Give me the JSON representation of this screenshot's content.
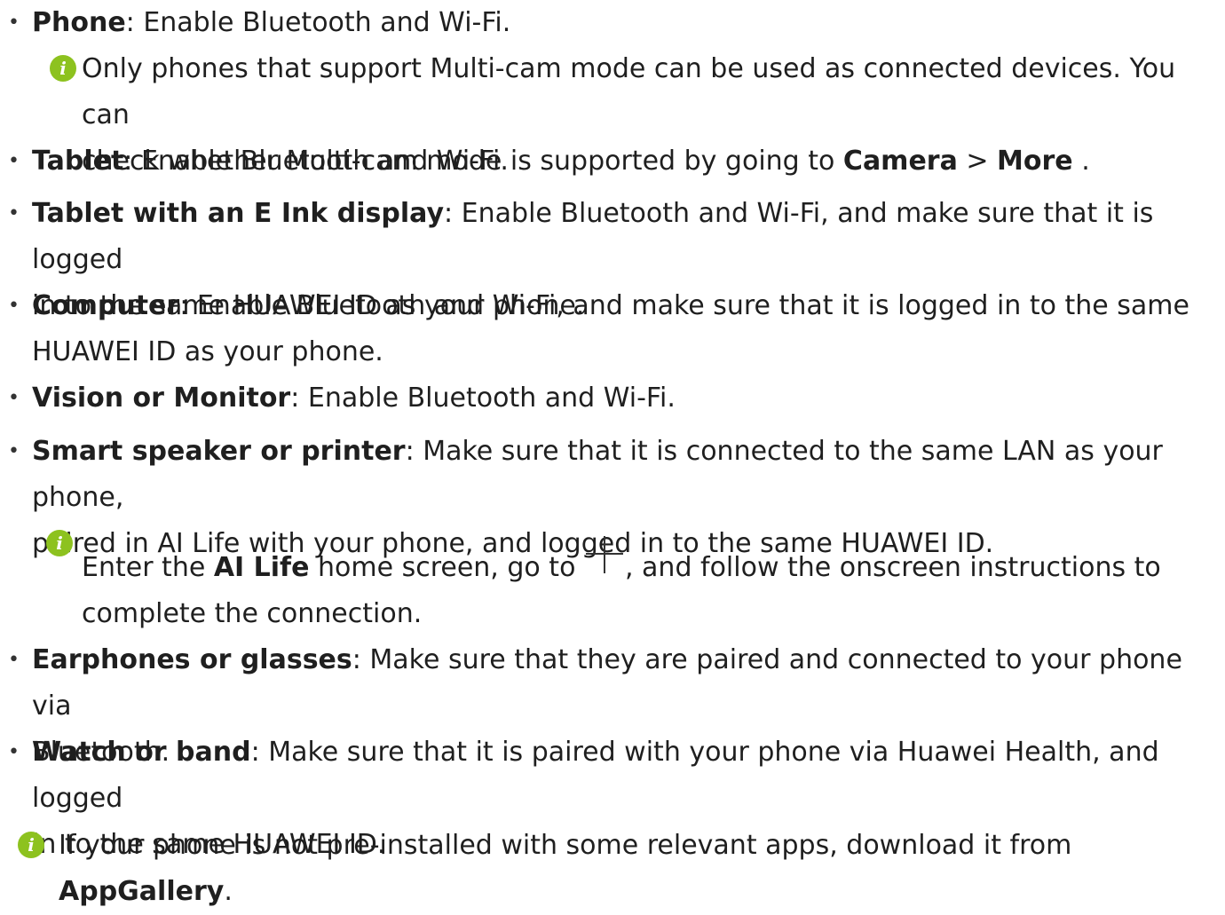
{
  "items": [
    {
      "bold": "Phone",
      "text": ": Enable Bluetooth and Wi-Fi."
    },
    {
      "bold": "Tablet",
      "text": ": Enable Bluetooth and Wi-Fi."
    },
    {
      "bold": "Tablet with an E Ink display",
      "text": ": Enable Bluetooth and Wi-Fi, and make sure that it is logged",
      "line2": "in to the same HUAWEI ID as your phone."
    },
    {
      "bold": "Computer",
      "text": ": Enable Bluetooth and Wi-Fi, and make sure that it is logged in to the same",
      "line2": "HUAWEI ID as your phone."
    },
    {
      "bold": "Vision or Monitor",
      "text": ": Enable Bluetooth and Wi-Fi."
    },
    {
      "bold": "Smart speaker or printer",
      "text": ": Make sure that it is connected to the same LAN as your phone,",
      "line2": "paired in AI Life with your phone, and logged in to the same HUAWEI ID."
    },
    {
      "bold": "Earphones or glasses",
      "text": ": Make sure that they are paired and connected to your phone via",
      "line2": "Bluetooth."
    },
    {
      "bold": "Watch or band",
      "text": ": Make sure that it is paired with your phone via Huawei Health, and logged",
      "line2": "in to the same HUAWEI ID."
    }
  ],
  "notes": {
    "multicam": {
      "line1": "Only phones that support Multi-cam mode can be used as connected devices. You can",
      "line2_pre": "check whether Multi-cam mode is supported by going to ",
      "camera": "Camera",
      "sep": " > ",
      "more": "More",
      "end": " ."
    },
    "ailife": {
      "pre": "Enter the ",
      "bold": "AI Life",
      "mid": " home screen, go to ",
      "post": ", and follow the onscreen instructions to",
      "line2": "complete the connection."
    },
    "apps": {
      "pre": "If your phone is not pre-installed with some relevant apps, download it from ",
      "bold": "AppGallery",
      "end": "."
    }
  },
  "bullet_char": "•",
  "icon_glyph": "i",
  "colors": {
    "info_icon": "#8dc21f",
    "text": "#1f1f1f"
  }
}
